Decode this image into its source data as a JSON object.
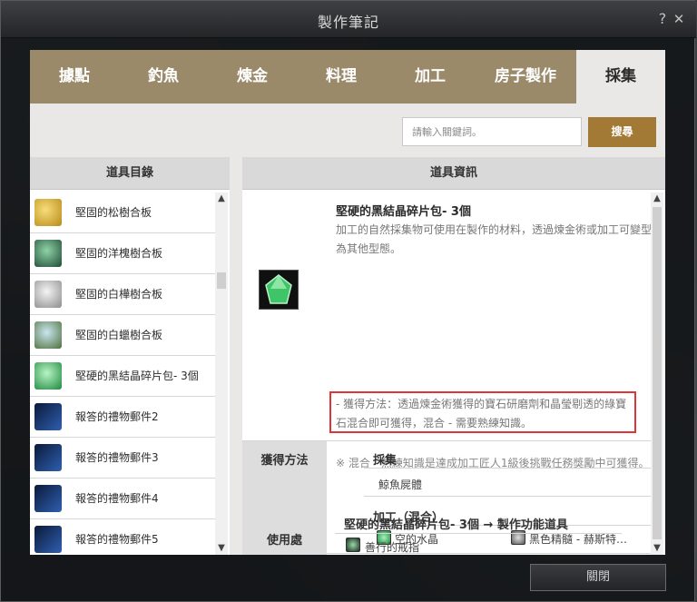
{
  "window": {
    "title": "製作筆記",
    "help_label": "?",
    "close_label": "✕"
  },
  "tabs": [
    {
      "label": "據點"
    },
    {
      "label": "釣魚"
    },
    {
      "label": "煉金"
    },
    {
      "label": "料理"
    },
    {
      "label": "加工"
    },
    {
      "label": "房子製作"
    },
    {
      "label": "採集"
    }
  ],
  "active_tab": "採集",
  "search": {
    "placeholder": "請輸入關鍵詞。",
    "button_label": "搜尋"
  },
  "item_list": {
    "header": "道具目錄",
    "items": [
      {
        "label": "堅固的松樹合板",
        "icon": "plank-gold-icon"
      },
      {
        "label": "堅固的洋槐樹合板",
        "icon": "plank-green-icon"
      },
      {
        "label": "堅固的白樺樹合板",
        "icon": "plank-white-icon"
      },
      {
        "label": "堅固的白蠟樹合板",
        "icon": "plank-mixed-icon"
      },
      {
        "label": "堅硬的黑結晶碎片包- 3個",
        "icon": "crystal-green-icon"
      },
      {
        "label": "報答的禮物郵件2",
        "icon": "gift-mail-icon"
      },
      {
        "label": "報答的禮物郵件3",
        "icon": "gift-mail-icon"
      },
      {
        "label": "報答的禮物郵件4",
        "icon": "gift-mail-icon"
      },
      {
        "label": "報答的禮物郵件5",
        "icon": "gift-mail-icon"
      }
    ]
  },
  "item_info": {
    "header": "道具資訊",
    "title": "堅硬的黑結晶碎片包- 3個",
    "description": "加工的自然採集物可使用在製作的材料，透過煉金術或加工可變型為其他型態。",
    "obtain_method": "- 獲得方法：透過煉金術獲得的寶石研磨劑和晶瑩剔透的綠寶石混合即可獲得，混合 - 需要熟練知識。",
    "mix_note": "※ 混合 - 熟練知識是達成加工匠人1級後挑戰任務獎勵中可獲得。",
    "obtain_section": {
      "label": "獲得方法",
      "gather_title": "採集",
      "gather_item": "鯨魚屍體",
      "process_title": "加工（混合）",
      "materials": [
        {
          "label": "空的水晶",
          "icon": "crystal-green-icon"
        },
        {
          "label": "黑色精髓 - 赫斯特…",
          "icon": "essence-gray-icon"
        }
      ]
    },
    "usage_section": {
      "label": "使用處",
      "title": "堅硬的黑結晶碎片包- 3個 → 製作功能道具",
      "result": {
        "label": "善行的戒指",
        "icon": "ring-icon"
      }
    }
  },
  "bottom_button": {
    "label": "關閉"
  },
  "colors": {
    "tab_bar": "#9a8a6a",
    "search_button": "#a37a35",
    "highlight_border": "#e0343a"
  }
}
